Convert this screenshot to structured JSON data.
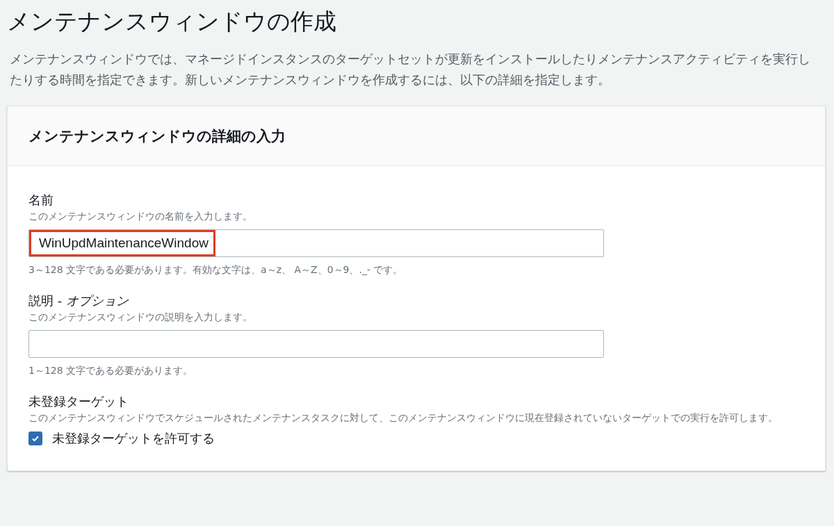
{
  "page": {
    "title": "メンテナンスウィンドウの作成",
    "description": "メンテナンスウィンドウでは、マネージドインスタンスのターゲットセットが更新をインストールしたりメンテナンスアクティビティを実行したりする時間を指定できます。新しいメンテナンスウィンドウを作成するには、以下の詳細を指定します。"
  },
  "panel": {
    "title": "メンテナンスウィンドウの詳細の入力",
    "fields": [
      {
        "kind": "text",
        "label": "名前",
        "hint": "このメンテナンスウィンドウの名前を入力します。",
        "value": "WinUpdMaintenanceWindow",
        "highlighted": true,
        "constraint": "3～128 文字である必要があります。有効な文字は、a～z、 A～Z、0～9、._- です。"
      },
      {
        "kind": "text",
        "label": "説明 - *オプション*",
        "hint": "このメンテナンスウィンドウの説明を入力します。",
        "highlighted": false,
        "constraint": "1～128 文字である必要があります。"
      },
      {
        "kind": "checkbox",
        "label": "未登録ターゲット",
        "hint": "このメンテナンスウィンドウでスケジュールされたメンテナンスタスクに対して、このメンテナンスウィンドウに現在登録されていないターゲットでの実行を許可します。",
        "option": "未登録ターゲットを許可する",
        "checked": true
      }
    ]
  }
}
